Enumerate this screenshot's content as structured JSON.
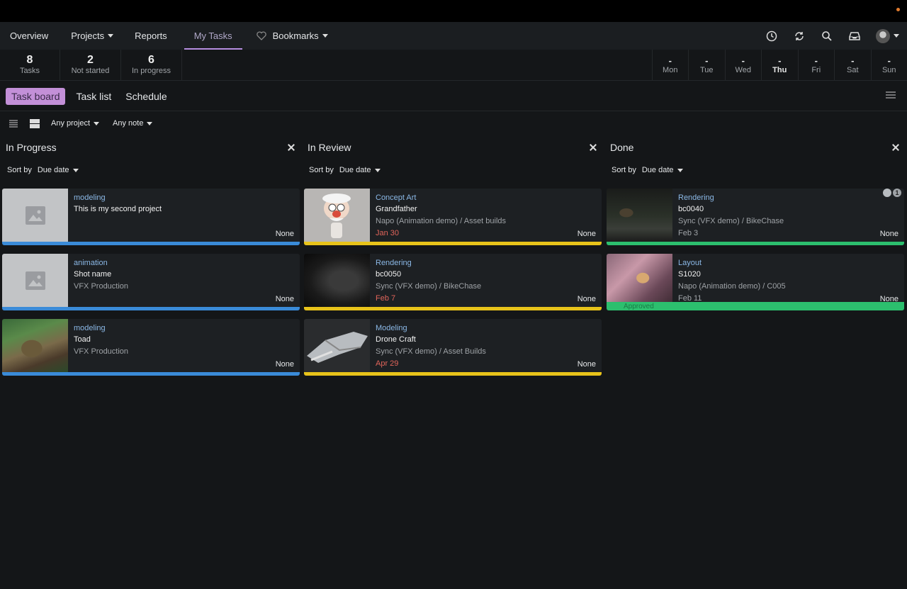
{
  "nav": {
    "items": [
      {
        "label": "Overview"
      },
      {
        "label": "Projects"
      },
      {
        "label": "Reports"
      },
      {
        "label": "My Tasks"
      },
      {
        "label": "Bookmarks"
      }
    ]
  },
  "stats": [
    {
      "num": "8",
      "label": "Tasks"
    },
    {
      "num": "2",
      "label": "Not started"
    },
    {
      "num": "6",
      "label": "In progress"
    }
  ],
  "days": [
    {
      "num": "-",
      "label": "Mon"
    },
    {
      "num": "-",
      "label": "Tue"
    },
    {
      "num": "-",
      "label": "Wed"
    },
    {
      "num": "-",
      "label": "Thu"
    },
    {
      "num": "-",
      "label": "Fri"
    },
    {
      "num": "-",
      "label": "Sat"
    },
    {
      "num": "-",
      "label": "Sun"
    }
  ],
  "views": [
    "Task board",
    "Task list",
    "Schedule"
  ],
  "filters": {
    "project": "Any project",
    "note": "Any note"
  },
  "sort": {
    "label": "Sort by",
    "value": "Due date"
  },
  "columns": [
    {
      "title": "In Progress",
      "cards": [
        {
          "type": "modeling",
          "name": "This is my second project",
          "project": "",
          "date": "",
          "status": "None"
        },
        {
          "type": "animation",
          "name": "Shot name",
          "project": "VFX Production",
          "date": "",
          "status": "None"
        },
        {
          "type": "modeling",
          "name": "Toad",
          "project": "VFX Production",
          "date": "",
          "status": "None"
        }
      ]
    },
    {
      "title": "In Review",
      "cards": [
        {
          "type": "Concept Art",
          "name": "Grandfather",
          "project": "Napo (Animation demo) / Asset builds",
          "date": "Jan 30",
          "status": "None"
        },
        {
          "type": "Rendering",
          "name": "bc0050",
          "project": "Sync (VFX demo) / BikeChase",
          "date": "Feb 7",
          "status": "None"
        },
        {
          "type": "Modeling",
          "name": "Drone Craft",
          "project": "Sync (VFX demo) / Asset Builds",
          "date": "Apr 29",
          "status": "None"
        }
      ]
    },
    {
      "title": "Done",
      "cards": [
        {
          "type": "Rendering",
          "name": "bc0040",
          "project": "Sync (VFX demo) / BikeChase",
          "date": "Feb 3",
          "status": "None",
          "badge": "1"
        },
        {
          "type": "Layout",
          "name": "S1020",
          "project": "Napo (Animation demo) / C005",
          "date": "Feb 11",
          "status": "None",
          "hover_label": "Approved"
        }
      ]
    }
  ],
  "colors": {
    "accent": "#c390d8",
    "blue": "#3a8bd8",
    "yellow": "#e8c31a",
    "green": "#2cbf6e",
    "date_red": "#e0645a"
  }
}
